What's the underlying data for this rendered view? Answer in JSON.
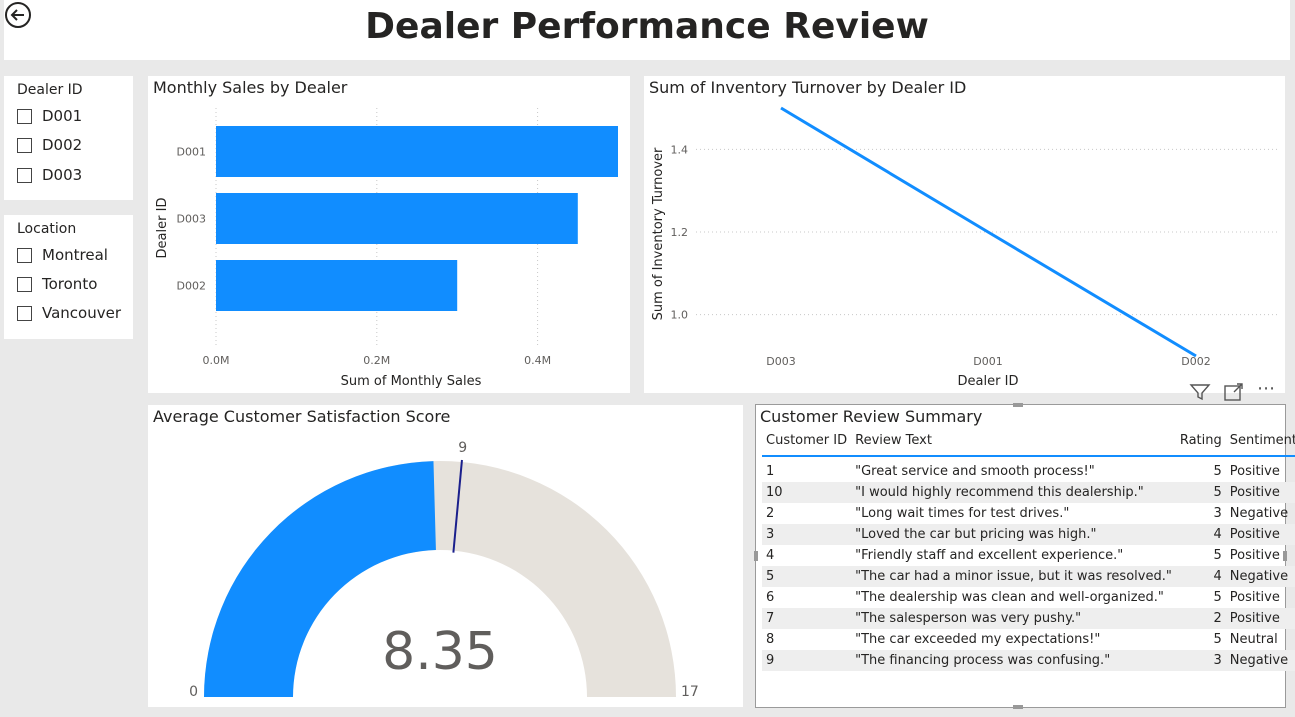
{
  "header": {
    "title": "Dealer Performance Review",
    "back_icon": "arrow-left-icon"
  },
  "slicers": [
    {
      "title": "Dealer ID",
      "options": [
        "D001",
        "D002",
        "D003"
      ]
    },
    {
      "title": "Location",
      "options": [
        "Montreal",
        "Toronto",
        "Vancouver"
      ]
    }
  ],
  "visuals": {
    "bar": {
      "title": "Monthly Sales by Dealer"
    },
    "line": {
      "title": "Sum of Inventory Turnover by Dealer ID"
    },
    "gauge": {
      "title": "Average Customer Satisfaction Score"
    },
    "table": {
      "title": "Customer Review Summary"
    }
  },
  "chart_data": [
    {
      "type": "bar",
      "title": "Monthly Sales by Dealer",
      "orientation": "horizontal",
      "categories": [
        "D001",
        "D003",
        "D002"
      ],
      "values": [
        0.5,
        0.45,
        0.3
      ],
      "xlabel": "Sum of Monthly Sales",
      "ylabel": "Dealer ID",
      "xlim": [
        0,
        0.5
      ],
      "x_ticks": [
        "0.0M",
        "0.2M",
        "0.4M"
      ],
      "color": "#118dff",
      "grid": true
    },
    {
      "type": "line",
      "title": "Sum of Inventory Turnover by Dealer ID",
      "categories": [
        "D003",
        "D001",
        "D002"
      ],
      "values": [
        1.5,
        1.2,
        0.9
      ],
      "xlabel": "Dealer ID",
      "ylabel": "Sum of Inventory Turnover",
      "ylim": [
        0.9,
        1.5
      ],
      "y_ticks": [
        "1.0",
        "1.2",
        "1.4"
      ],
      "color": "#118dff",
      "grid": true
    },
    {
      "type": "gauge",
      "title": "Average Customer Satisfaction Score",
      "value": 8.35,
      "value_label": "8.35",
      "min": 0,
      "max": 17,
      "min_label": "0",
      "max_label": "17",
      "target": 9,
      "target_label": "9",
      "fill_color": "#118dff",
      "track_color": "#e6e2dc",
      "target_color": "#1a1f8c"
    }
  ],
  "review_table": {
    "columns": [
      "Customer ID",
      "Review Text",
      "Rating",
      "Sentiment"
    ],
    "rows": [
      [
        "1",
        "\"Great service and smooth process!\"",
        "5",
        "Positive"
      ],
      [
        "10",
        "\"I would highly recommend this dealership.\"",
        "5",
        "Positive"
      ],
      [
        "2",
        "\"Long wait times for test drives.\"",
        "3",
        "Negative"
      ],
      [
        "3",
        "\"Loved the car but pricing was high.\"",
        "4",
        "Positive"
      ],
      [
        "4",
        "\"Friendly staff and excellent experience.\"",
        "5",
        "Positive"
      ],
      [
        "5",
        "\"The car had a minor issue, but it was resolved.\"",
        "4",
        "Negative"
      ],
      [
        "6",
        "\"The dealership was clean and well-organized.\"",
        "5",
        "Positive"
      ],
      [
        "7",
        "\"The salesperson was very pushy.\"",
        "2",
        "Positive"
      ],
      [
        "8",
        "\"The car exceeded my expectations!\"",
        "5",
        "Neutral"
      ],
      [
        "9",
        "\"The financing process was confusing.\"",
        "3",
        "Negative"
      ]
    ]
  },
  "toolbar_icons": [
    "filter-icon",
    "focus-mode-icon",
    "more-options-icon"
  ]
}
